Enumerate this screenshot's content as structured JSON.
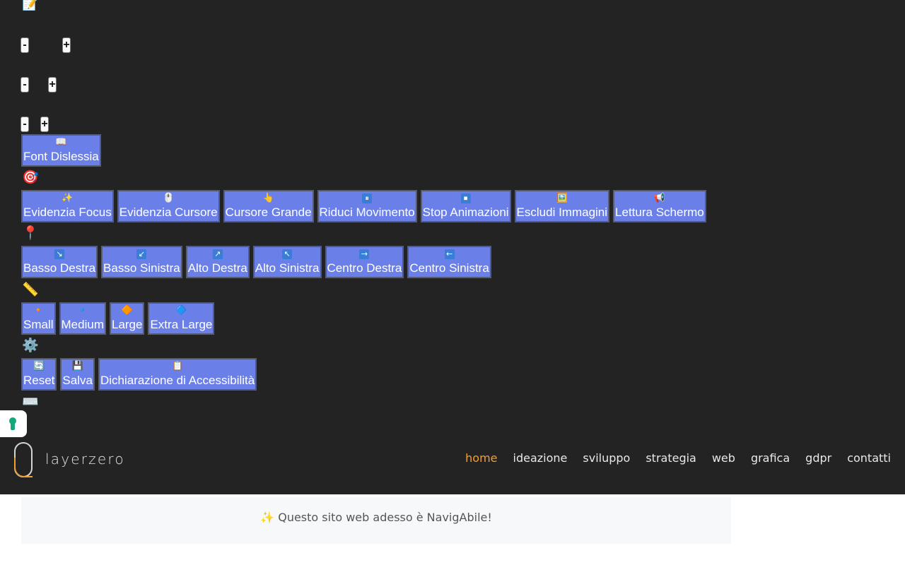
{
  "accessibility_panel": {
    "sections": {
      "text_icon": "📝",
      "target_icon": "🎯",
      "position_icon": "📍",
      "size_icon": "📏",
      "settings_icon": "⚙️",
      "keyboard_icon": "⌨️"
    },
    "steppers": [
      {
        "minus": "-",
        "plus": "+"
      },
      {
        "minus": "-",
        "plus": "+"
      },
      {
        "minus": "-",
        "plus": "+"
      }
    ],
    "dyslexia_font": {
      "icon": "📖",
      "label": "Font Dislessia"
    },
    "features": [
      {
        "icon": "✨",
        "label": "Evidenzia Focus"
      },
      {
        "icon": "🖱️",
        "label": "Evidenzia Cursore"
      },
      {
        "icon": "👆",
        "label": "Cursore Grande"
      },
      {
        "icon": "⏸",
        "label": "Riduci Movimento"
      },
      {
        "icon": "⏹",
        "label": "Stop Animazioni"
      },
      {
        "icon": "🖼️",
        "label": "Escludi Immagini"
      },
      {
        "icon": "📢",
        "label": "Lettura Schermo"
      }
    ],
    "positions": [
      {
        "icon": "↘",
        "label": "Basso Destra"
      },
      {
        "icon": "↙",
        "label": "Basso Sinistra"
      },
      {
        "icon": "↗",
        "label": "Alto Destra"
      },
      {
        "icon": "↖",
        "label": "Alto Sinistra"
      },
      {
        "icon": "→",
        "label": "Centro Destra"
      },
      {
        "icon": "←",
        "label": "Centro Sinistra"
      }
    ],
    "sizes": [
      {
        "icon": "🔸",
        "label": "Small"
      },
      {
        "icon": "🔹",
        "label": "Medium"
      },
      {
        "icon": "🔶",
        "label": "Large"
      },
      {
        "icon": "🔷",
        "label": "Extra Large"
      }
    ],
    "actions": [
      {
        "icon": "🔄",
        "label": "Reset"
      },
      {
        "icon": "💾",
        "label": "Salva"
      },
      {
        "icon": "📋",
        "label": "Dichiarazione di Accessibilità"
      }
    ]
  },
  "navbar": {
    "brand": "layerzero",
    "links": [
      "home",
      "ideazione",
      "sviluppo",
      "strategia",
      "web",
      "grafica",
      "gdpr",
      "contatti"
    ],
    "active": "home"
  },
  "notice": {
    "text": "✨ Questo sito web adesso è NavigAbile!"
  },
  "colors": {
    "button_bg": "#6b7fe8",
    "page_bg": "#232323",
    "accent": "#f0a030"
  }
}
